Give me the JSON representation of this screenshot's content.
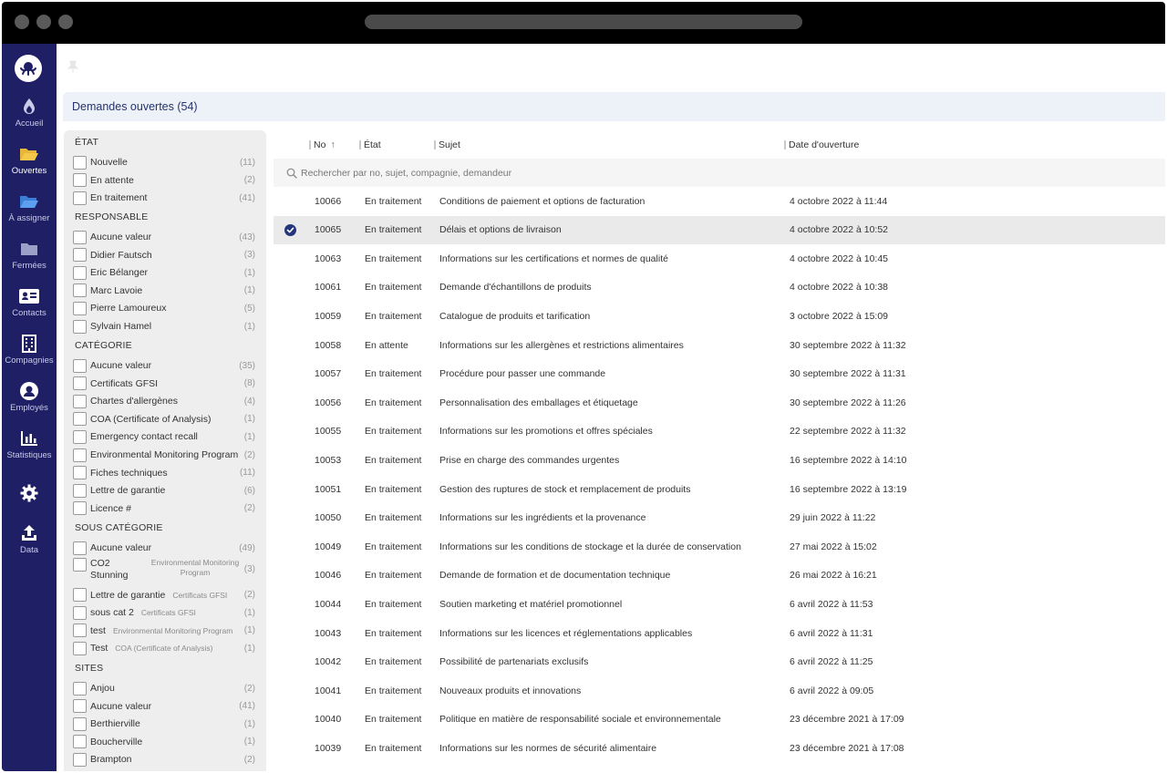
{
  "nav": {
    "items": [
      {
        "label": "Accueil",
        "icon": "drop-icon"
      },
      {
        "label": "Ouvertes",
        "icon": "folder-open-icon"
      },
      {
        "label": "À assigner",
        "icon": "folder-open-icon"
      },
      {
        "label": "Fermées",
        "icon": "folder-icon"
      },
      {
        "label": "Contacts",
        "icon": "contact-card-icon"
      },
      {
        "label": "Compagnies",
        "icon": "building-icon"
      },
      {
        "label": "Employés",
        "icon": "user-icon"
      },
      {
        "label": "Statistiques",
        "icon": "bar-chart-icon"
      },
      {
        "label": "",
        "icon": "gear-icon"
      },
      {
        "label": "Data",
        "icon": "upload-icon"
      }
    ]
  },
  "header": {
    "title": "Demandes ouvertes (54)"
  },
  "filters": {
    "etat": {
      "title": "ÉTAT",
      "items": [
        {
          "label": "Nouvelle",
          "count": "(11)"
        },
        {
          "label": "En attente",
          "count": "(2)"
        },
        {
          "label": "En traitement",
          "count": "(41)"
        }
      ]
    },
    "responsable": {
      "title": "RESPONSABLE",
      "items": [
        {
          "label": "Aucune valeur",
          "count": "(43)"
        },
        {
          "label": "Didier Fautsch",
          "count": "(3)"
        },
        {
          "label": "Eric Bélanger",
          "count": "(1)"
        },
        {
          "label": "Marc Lavoie",
          "count": "(1)"
        },
        {
          "label": "Pierre Lamoureux",
          "count": "(5)"
        },
        {
          "label": "Sylvain Hamel",
          "count": "(1)"
        }
      ]
    },
    "categorie": {
      "title": "CATÉGORIE",
      "items": [
        {
          "label": "Aucune valeur",
          "count": "(35)"
        },
        {
          "label": "Certificats GFSI",
          "count": "(8)"
        },
        {
          "label": "Chartes d'allergènes",
          "count": "(4)"
        },
        {
          "label": "COA (Certificate of Analysis)",
          "count": "(1)"
        },
        {
          "label": "Emergency contact recall",
          "count": "(1)"
        },
        {
          "label": "Environmental Monitoring Program",
          "count": "(2)"
        },
        {
          "label": "Fiches techniques",
          "count": "(11)"
        },
        {
          "label": "Lettre de garantie",
          "count": "(6)"
        },
        {
          "label": "Licence #",
          "count": "(2)"
        }
      ]
    },
    "sous_categorie": {
      "title": "SOUS CATÉGORIE",
      "items": [
        {
          "label": "Aucune valeur",
          "sub": "",
          "count": "(49)"
        },
        {
          "label": "CO2 Stunning",
          "sub": "Environmental Monitoring Program",
          "count": "(3)"
        },
        {
          "label": "Lettre de garantie",
          "sub": "Certificats GFSI",
          "count": "(2)"
        },
        {
          "label": "sous cat 2",
          "sub": "Certificats GFSI",
          "count": "(1)"
        },
        {
          "label": "test",
          "sub": "Environmental Monitoring Program",
          "count": "(1)"
        },
        {
          "label": "Test",
          "sub": "COA (Certificate of Analysis)",
          "count": "(1)"
        }
      ]
    },
    "sites": {
      "title": "SITES",
      "items": [
        {
          "label": "Anjou",
          "count": "(2)"
        },
        {
          "label": "Aucune valeur",
          "count": "(41)"
        },
        {
          "label": "Berthierville",
          "count": "(1)"
        },
        {
          "label": "Boucherville",
          "count": "(1)"
        },
        {
          "label": "Brampton",
          "count": "(2)"
        }
      ]
    }
  },
  "table": {
    "columns": {
      "no": "No",
      "etat": "État",
      "sujet": "Sujet",
      "date": "Date d'ouverture"
    },
    "sort_indicator": "↑",
    "search_placeholder": "Rechercher par no, sujet, compagnie, demandeur",
    "selected_row": 1,
    "rows": [
      {
        "no": "10066",
        "etat": "En traitement",
        "sujet": "Conditions de paiement et options de facturation",
        "date": "4 octobre 2022 à 11:44"
      },
      {
        "no": "10065",
        "etat": "En traitement",
        "sujet": "Délais et options de livraison",
        "date": "4 octobre 2022 à 10:52"
      },
      {
        "no": "10063",
        "etat": "En traitement",
        "sujet": "Informations sur les certifications et normes de qualité",
        "date": "4 octobre 2022 à 10:45"
      },
      {
        "no": "10061",
        "etat": "En traitement",
        "sujet": "Demande d'échantillons de produits",
        "date": "4 octobre 2022 à 10:38"
      },
      {
        "no": "10059",
        "etat": "En traitement",
        "sujet": "Catalogue de produits et tarification",
        "date": "3 octobre 2022 à 15:09"
      },
      {
        "no": "10058",
        "etat": "En attente",
        "sujet": "Informations sur les allergènes et restrictions alimentaires",
        "date": "30 septembre 2022 à 11:32"
      },
      {
        "no": "10057",
        "etat": "En traitement",
        "sujet": "Procédure pour passer une commande",
        "date": "30 septembre 2022 à 11:31"
      },
      {
        "no": "10056",
        "etat": "En traitement",
        "sujet": "Personnalisation des emballages et étiquetage",
        "date": "30 septembre 2022 à 11:26"
      },
      {
        "no": "10055",
        "etat": "En traitement",
        "sujet": "Informations sur les promotions et offres spéciales",
        "date": "22 septembre 2022 à 11:32"
      },
      {
        "no": "10053",
        "etat": "En traitement",
        "sujet": "Prise en charge des commandes urgentes",
        "date": "16 septembre 2022 à 14:10"
      },
      {
        "no": "10051",
        "etat": "En traitement",
        "sujet": "Gestion des ruptures de stock et remplacement de produits",
        "date": "16 septembre 2022 à 13:19"
      },
      {
        "no": "10050",
        "etat": "En traitement",
        "sujet": "Informations sur les ingrédients et la provenance",
        "date": "29 juin 2022 à 11:22"
      },
      {
        "no": "10049",
        "etat": "En traitement",
        "sujet": "Informations sur les conditions de stockage et la durée de conservation",
        "date": "27 mai 2022 à 15:02"
      },
      {
        "no": "10046",
        "etat": "En traitement",
        "sujet": "Demande de formation et de documentation technique",
        "date": "26 mai 2022 à 16:21"
      },
      {
        "no": "10044",
        "etat": "En traitement",
        "sujet": "Soutien marketing et matériel promotionnel",
        "date": "6 avril 2022 à 11:53"
      },
      {
        "no": "10043",
        "etat": "En traitement",
        "sujet": "Informations sur les licences et réglementations applicables",
        "date": "6 avril 2022 à 11:31"
      },
      {
        "no": "10042",
        "etat": "En traitement",
        "sujet": "Possibilité de partenariats exclusifs",
        "date": "6 avril 2022 à 11:25"
      },
      {
        "no": "10041",
        "etat": "En traitement",
        "sujet": "Nouveaux produits et innovations",
        "date": "6 avril 2022 à 09:05"
      },
      {
        "no": "10040",
        "etat": "En traitement",
        "sujet": "Politique en matière de responsabilité sociale et environnementale",
        "date": "23 décembre 2021 à 17:09"
      },
      {
        "no": "10039",
        "etat": "En traitement",
        "sujet": "Informations sur les normes de sécurité alimentaire",
        "date": "23 décembre 2021 à 17:08"
      }
    ]
  }
}
